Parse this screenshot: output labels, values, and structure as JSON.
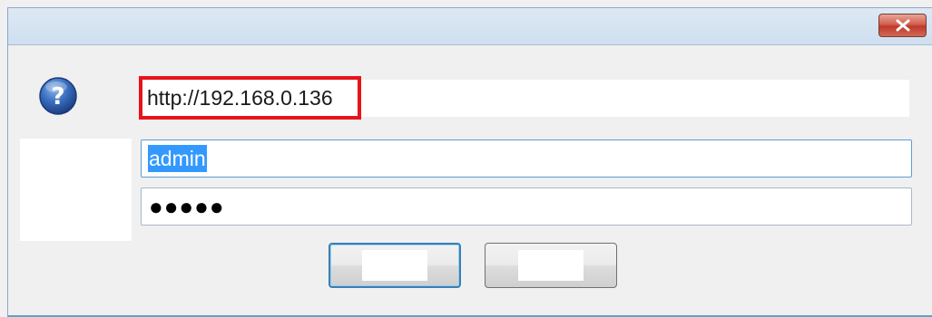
{
  "dialog": {
    "title": "",
    "close_icon": "close-x-icon",
    "close_color": "#c0392b"
  },
  "prompt": {
    "icon": "question-mark-icon",
    "icon_color": "#2d62b2"
  },
  "url": {
    "value": "http://192.168.0.136",
    "highlight_color": "#e8131b"
  },
  "username": {
    "value": "admin",
    "selection_color": "#3399ff"
  },
  "password": {
    "masked_value": "●●●●●"
  },
  "buttons": {
    "ok_label": "",
    "cancel_label": ""
  }
}
